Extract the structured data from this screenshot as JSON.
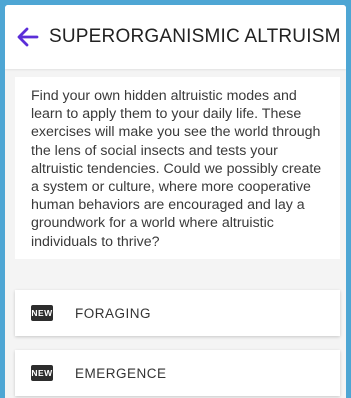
{
  "header": {
    "title": "SUPERORGANISMIC ALTRUISM",
    "back_icon": "arrow-left-icon",
    "accent_color": "#5b2ed8"
  },
  "description": "Find your own hidden altruistic modes and learn to apply them to your daily life. These exercises will make you see the world through the lens of social insects and tests your altruistic tendencies. Could we possibly create a system or culture, where more cooperative human behaviors are encouraged and lay a groundwork for a world where altruistic individuals to thrive?",
  "items": [
    {
      "badge": "NEW",
      "label": "FORAGING"
    },
    {
      "badge": "NEW",
      "label": "EMERGENCE"
    }
  ]
}
